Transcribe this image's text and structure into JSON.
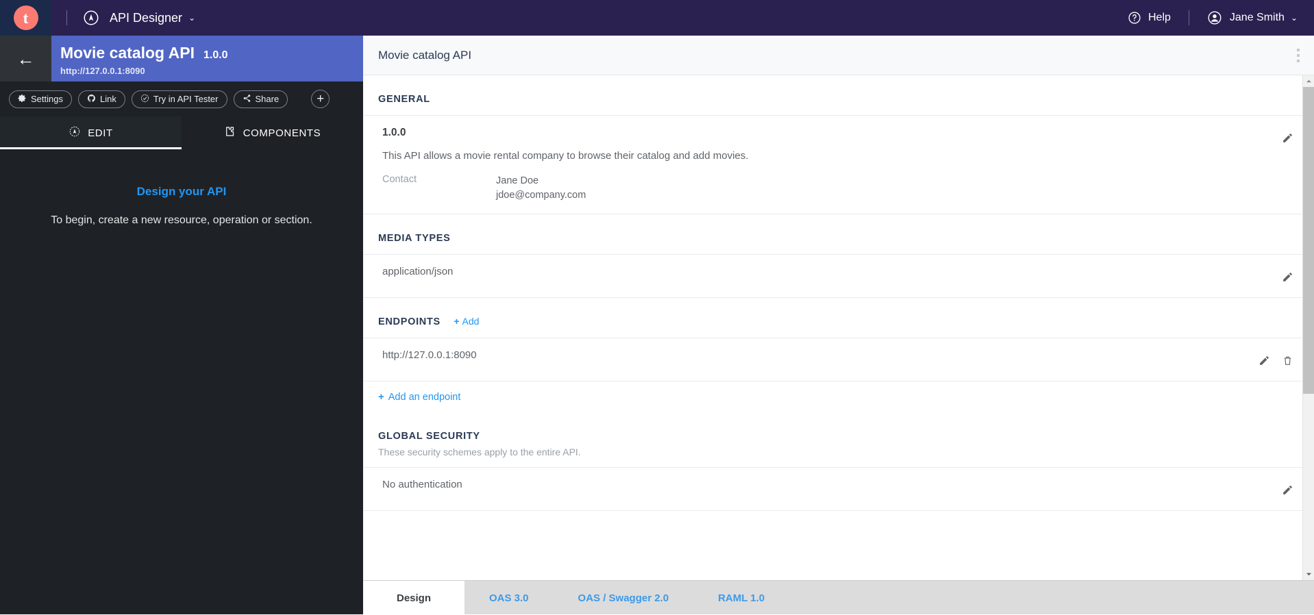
{
  "topbar": {
    "logo_letter": "t",
    "logo_icon": "compass-icon",
    "app_name": "API Designer",
    "app_caret": "⌄",
    "help_label": "Help",
    "help_icon": "help-circle-icon",
    "user_name": "Jane Smith",
    "user_icon": "user-avatar-icon",
    "user_caret": "⌄",
    "bg_color": "#2b2150",
    "logo_color": "#fb7b72"
  },
  "sidebar": {
    "back_icon": "back-arrow-icon",
    "back_glyph": "←",
    "api_title": "Movie catalog API",
    "api_version": "1.0.0",
    "api_url": "http://127.0.0.1:8090",
    "band_color": "#5165c4",
    "buttons": [
      {
        "label": "Settings",
        "icon": "gear-icon"
      },
      {
        "label": "Link",
        "icon": "github-icon"
      },
      {
        "label": "Try in API Tester",
        "icon": "check-circle-icon"
      },
      {
        "label": "Share",
        "icon": "share-nodes-icon"
      }
    ],
    "add_button_glyph": "+",
    "tabs": [
      {
        "label": "EDIT",
        "icon": "compass-icon",
        "active": true
      },
      {
        "label": "COMPONENTS",
        "icon": "puzzle-piece-icon",
        "active": false
      }
    ],
    "empty_title": "Design your API",
    "empty_subtitle": "To begin, create a new resource, operation or section.",
    "empty_title_color": "#2196f3"
  },
  "main": {
    "header_title": "Movie catalog API",
    "kebab_icon": "more-vertical-icon",
    "sections": {
      "general": {
        "title": "GENERAL",
        "version": "1.0.0",
        "description": "This API allows a movie rental company to browse their catalog and add movies.",
        "contact_key": "Contact",
        "contact_name": "Jane Doe",
        "contact_email": "jdoe@company.com",
        "edit_icon": "pencil-icon"
      },
      "media_types": {
        "title": "MEDIA TYPES",
        "value": "application/json",
        "edit_icon": "pencil-icon"
      },
      "endpoints": {
        "title": "ENDPOINTS",
        "add_label": "Add",
        "add_plus": "+",
        "value": "http://127.0.0.1:8090",
        "edit_icon": "pencil-icon",
        "delete_icon": "trash-icon",
        "add_link_label": "Add an endpoint",
        "add_link_plus": "+"
      },
      "global_security": {
        "title": "GLOBAL SECURITY",
        "description": "These security schemes apply to the entire API.",
        "value": "No authentication",
        "edit_icon": "pencil-icon"
      }
    },
    "scrollbar": {
      "up_icon": "scroll-up-arrow-icon",
      "down_icon": "scroll-down-arrow-icon",
      "thumb": "scroll-thumb"
    }
  },
  "bottom_tabs": [
    {
      "label": "Design",
      "active": true
    },
    {
      "label": "OAS 3.0",
      "active": false
    },
    {
      "label": "OAS / Swagger 2.0",
      "active": false
    },
    {
      "label": "RAML 1.0",
      "active": false
    }
  ]
}
